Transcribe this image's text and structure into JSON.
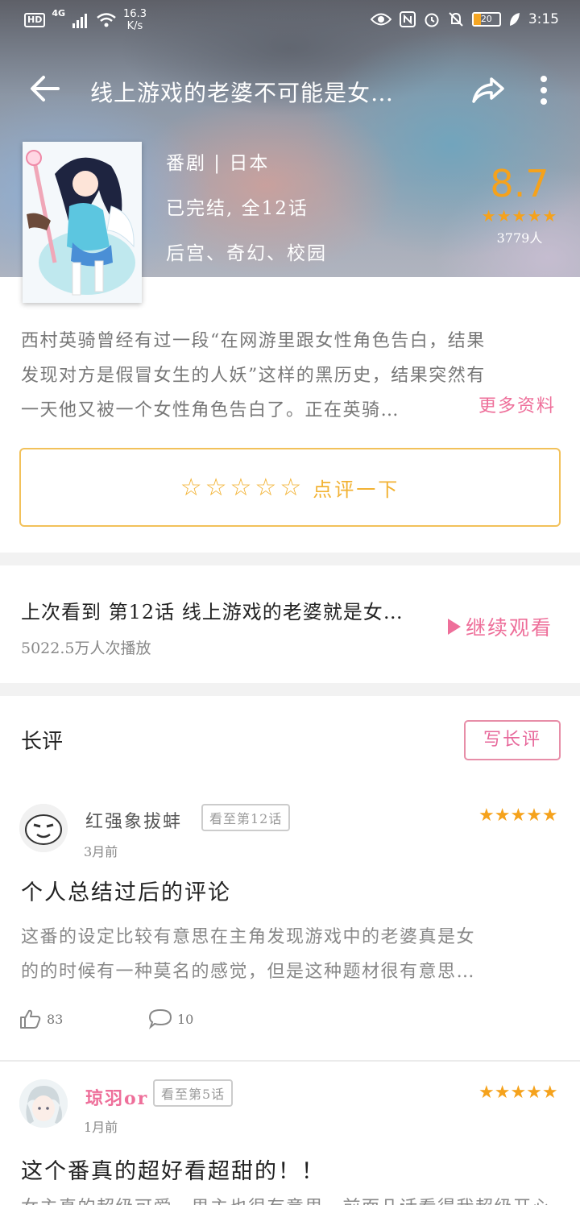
{
  "status_bar": {
    "hd": "HD",
    "network": "4G",
    "speed_value": "16.3",
    "speed_unit": "K/s",
    "battery": "20",
    "time": "3:15"
  },
  "header": {
    "title": "线上游戏的老婆不可能是女…",
    "category": "番剧 | 日本",
    "status": "已完结, 全12话",
    "tags": "后宫、奇幻、校园",
    "score": "8.7",
    "score_stars": "★★★★★",
    "rating_count": "3779人"
  },
  "synopsis": {
    "lines": [
      "西村英骑曾经有过一段“在网游里跟女性角色告白，结果",
      "发现对方是假冒女生的人妖”这样的黑历史，结果突然有",
      "一天他又被一个女性角色告白了。正在英骑…"
    ],
    "more_label": "更多资料"
  },
  "rate": {
    "stars": "☆☆☆☆☆",
    "label": "点评一下"
  },
  "last_watched": {
    "text": "上次看到 第12话 线上游戏的老婆就是女…",
    "plays": "5022.5万人次播放",
    "continue_label": "继续观看"
  },
  "reviews": {
    "title": "长评",
    "write_label": "写长评",
    "items": [
      {
        "username": "红强象拔蚌",
        "progress": "看至第12话",
        "time": "3月前",
        "stars": "★★★★★",
        "heading": "个人总结过后的评论",
        "body": [
          "这番的设定比较有意思在主角发现游戏中的老婆真是女",
          "的的时候有一种莫名的感觉，但是这种题材很有意思…"
        ],
        "likes": "83",
        "comments": "10"
      },
      {
        "username": "琼羽or",
        "progress": "看至第5话",
        "time": "1月前",
        "stars": "★★★★★",
        "heading": "这个番真的超好看超甜的！！",
        "body": [
          "女主真的超级可爱，男主也很有意思，前面几话看得我超级开心"
        ]
      }
    ]
  },
  "colors": {
    "accent_pink": "#ee6f9a",
    "star_orange": "#f5a21c"
  }
}
